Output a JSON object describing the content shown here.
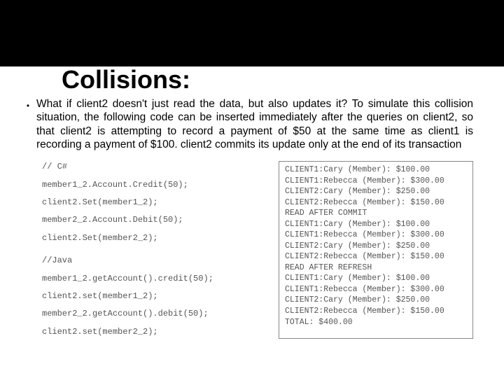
{
  "title": "Collisions:",
  "bullet": "What if client2 doesn't just read the data, but also updates it? To simulate this collision situation, the following code can be inserted immediately after the queries on client2, so that client2 is attempting to record a payment of $50 at the same time as client1 is recording a payment of $100. client2 commits its update only at the end of its transaction",
  "code_left": {
    "csharp_comment": "// C#",
    "csharp_l1": "member1_2.Account.Credit(50);",
    "csharp_l2": "client2.Set(member1_2);",
    "csharp_l3": "member2_2.Account.Debit(50);",
    "csharp_l4": "client2.Set(member2_2);",
    "java_comment": "//Java",
    "java_l1": "member1_2.getAccount().credit(50);",
    "java_l2": "client2.set(member1_2);",
    "java_l3": "member2_2.getAccount().debit(50);",
    "java_l4": "client2.set(member2_2);"
  },
  "code_right": "CLIENT1:Cary (Member): $100.00\nCLIENT1:Rebecca (Member): $300.00\nCLIENT2:Cary (Member): $250.00\nCLIENT2:Rebecca (Member): $150.00\nREAD AFTER COMMIT\nCLIENT1:Cary (Member): $100.00\nCLIENT1:Rebecca (Member): $300.00\nCLIENT2:Cary (Member): $250.00\nCLIENT2:Rebecca (Member): $150.00\nREAD AFTER REFRESH\nCLIENT1:Cary (Member): $100.00\nCLIENT1:Rebecca (Member): $300.00\nCLIENT2:Cary (Member): $250.00\nCLIENT2:Rebecca (Member): $150.00\nTOTAL: $400.00"
}
